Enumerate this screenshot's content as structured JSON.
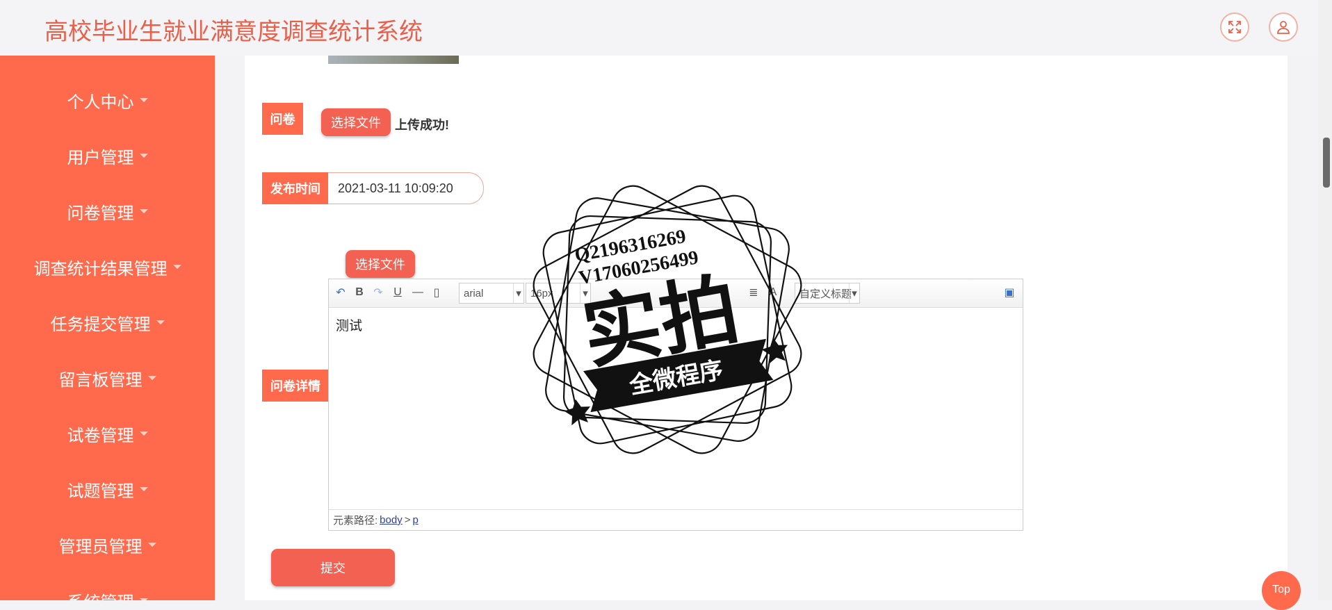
{
  "app": {
    "title": "高校毕业生就业满意度调查统计系统",
    "accent_color": "#ff6a4d"
  },
  "header_buttons": [
    {
      "name": "fullscreen",
      "icon": "expand-icon"
    },
    {
      "name": "user",
      "icon": "user-icon"
    }
  ],
  "sidebar": {
    "items": [
      {
        "label": "个人中心"
      },
      {
        "label": "用户管理"
      },
      {
        "label": "问卷管理"
      },
      {
        "label": "调查统计结果管理"
      },
      {
        "label": "任务提交管理"
      },
      {
        "label": "留言板管理"
      },
      {
        "label": "试卷管理"
      },
      {
        "label": "试题管理"
      },
      {
        "label": "管理员管理"
      },
      {
        "label": "系统管理"
      }
    ]
  },
  "form": {
    "questionnaire_label": "问卷",
    "choose_file": "选择文件",
    "upload_status": "上传成功!",
    "publish_time_label": "发布时间",
    "publish_time_value": "2021-03-11 10:09:20",
    "details_label": "问卷详情",
    "submit": "提交"
  },
  "editor": {
    "font_family": "arial",
    "font_size": "16px",
    "custom_title": "自定义标题",
    "content": "测试",
    "path_label": "元素路径:",
    "path_body": "body",
    "path_sep": ">",
    "path_p": "p"
  },
  "watermark": {
    "line1": "Q2196316269",
    "line2": "V17060256499",
    "main": "实拍",
    "banner": "全微程序"
  },
  "top_button": "Top"
}
